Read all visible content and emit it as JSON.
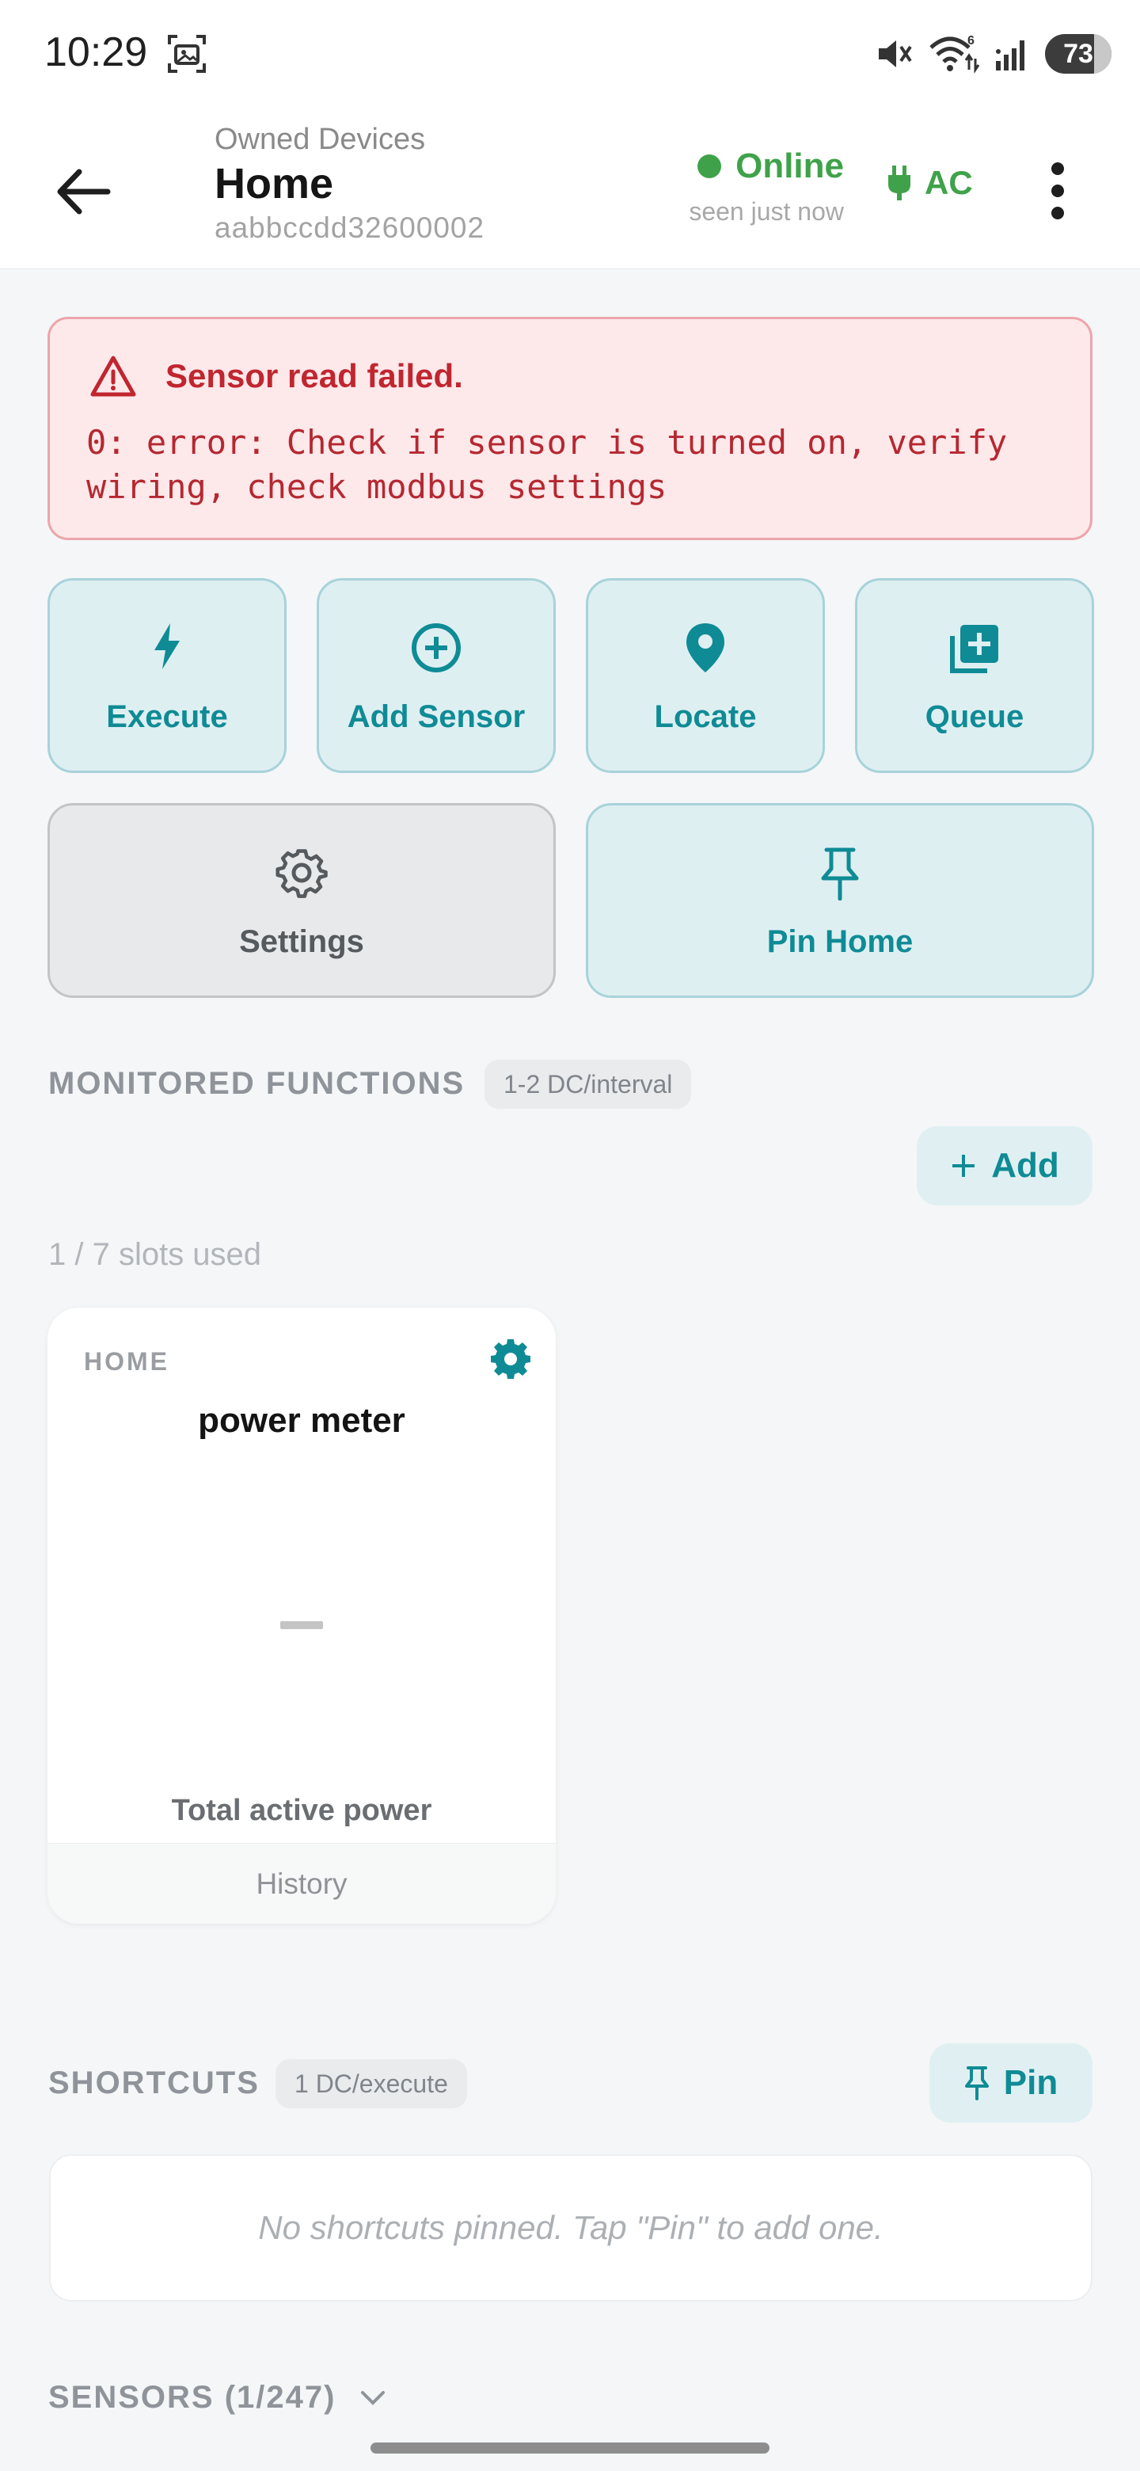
{
  "status_bar": {
    "time": "10:29",
    "battery": "73",
    "wifi_badge": "6",
    "icons": [
      "screenshot-icon",
      "mute-icon",
      "wifi-icon",
      "signal-icon",
      "battery-icon"
    ]
  },
  "header": {
    "breadcrumb": "Owned Devices",
    "title": "Home",
    "device_id": "aabbccdd32600002",
    "status": "Online",
    "seen": "seen just now",
    "power_source": "AC",
    "status_color": "#3fa24a"
  },
  "error": {
    "title": "Sensor read failed.",
    "message": "0: error: Check if sensor is turned on, verify\nwiring, check modbus settings",
    "color": "#c0262f"
  },
  "actions": [
    {
      "label": "Execute",
      "icon": "bolt-icon"
    },
    {
      "label": "Add Sensor",
      "icon": "add-circle-icon"
    },
    {
      "label": "Locate",
      "icon": "location-pin-icon"
    },
    {
      "label": "Queue",
      "icon": "add-to-queue-icon"
    },
    {
      "label": "Settings",
      "icon": "gear-icon"
    },
    {
      "label": "Pin Home",
      "icon": "pin-icon"
    }
  ],
  "monitored": {
    "title": "MONITORED FUNCTIONS",
    "chip": "1-2 DC/interval",
    "add_label": "Add",
    "slots": "1 / 7 slots used",
    "cards": [
      {
        "device": "HOME",
        "title": "power meter",
        "value": "—",
        "subtitle": "Total active power",
        "history_label": "History"
      }
    ]
  },
  "shortcuts": {
    "title": "SHORTCUTS",
    "chip": "1 DC/execute",
    "pin_label": "Pin",
    "empty_text": "No shortcuts pinned. Tap \"Pin\" to add one."
  },
  "sensors": {
    "title": "SENSORS (1/247)"
  },
  "accent_color": "#0f8b95"
}
